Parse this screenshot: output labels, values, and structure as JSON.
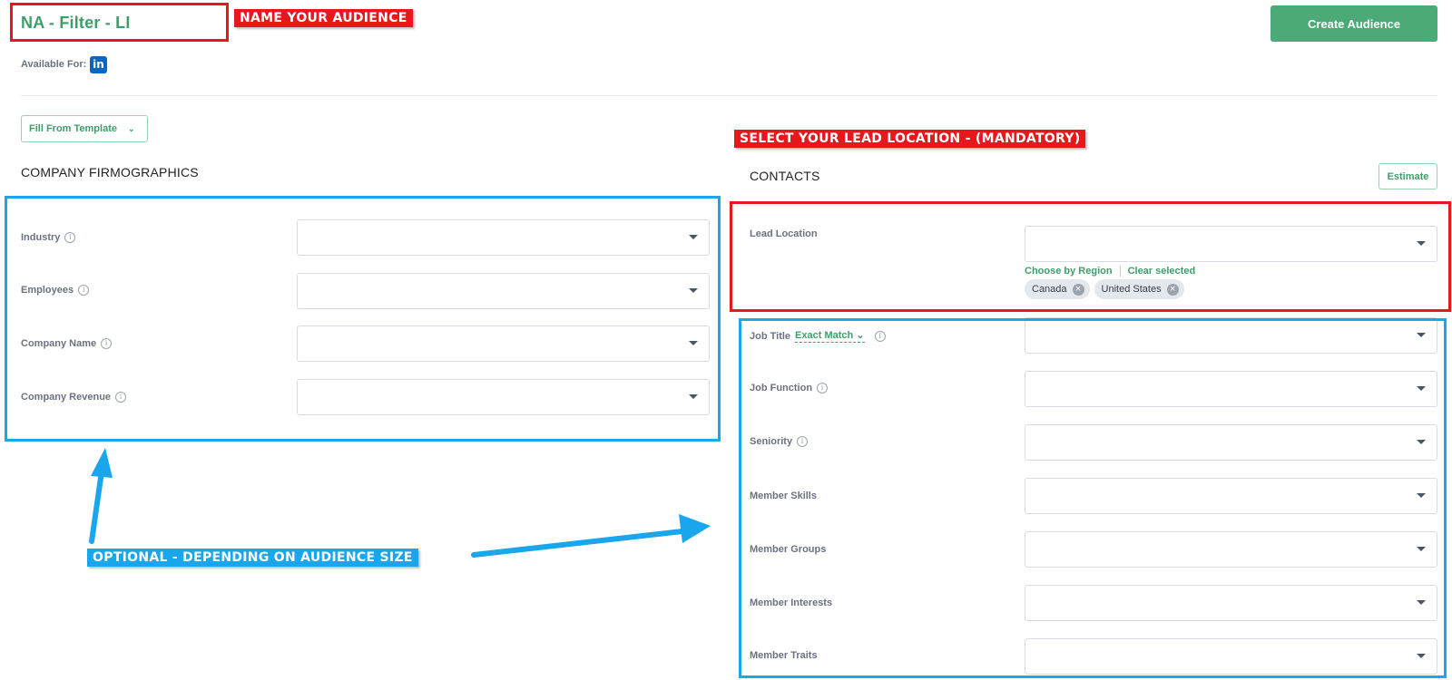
{
  "header": {
    "audience_name": "NA - Filter - LI",
    "available_for_label": "Available For:",
    "linkedin_icon": "linkedin-icon",
    "create_button": "Create Audience"
  },
  "toolbar": {
    "template_button": "Fill From Template"
  },
  "company": {
    "title": "COMPANY FIRMOGRAPHICS",
    "fields": [
      {
        "label": "Industry",
        "info": true
      },
      {
        "label": "Employees",
        "info": true
      },
      {
        "label": "Company Name",
        "info": true
      },
      {
        "label": "Company Revenue",
        "info": true
      }
    ]
  },
  "contacts": {
    "title": "CONTACTS",
    "estimate_button": "Estimate",
    "lead_location": {
      "label": "Lead Location",
      "choose_by_region": "Choose by Region",
      "clear_selected": "Clear selected",
      "selected": [
        "Canada",
        "United States"
      ]
    },
    "job_title": {
      "label": "Job Title",
      "match_mode": "Exact Match",
      "info": true
    },
    "fields": [
      {
        "label": "Job Function",
        "info": true
      },
      {
        "label": "Seniority",
        "info": true
      },
      {
        "label": "Member Skills",
        "info": false
      },
      {
        "label": "Member Groups",
        "info": false
      },
      {
        "label": "Member Interests",
        "info": false
      },
      {
        "label": "Member Traits",
        "info": false
      }
    ]
  },
  "annotations": {
    "name_audience": "NAME YOUR AUDIENCE",
    "lead_location": "SELECT YOUR LEAD LOCATION - (MANDATORY)",
    "optional": "OPTIONAL - DEPENDING ON AUDIENCE SIZE"
  },
  "colors": {
    "brand_green": "#4caa79",
    "link_green": "#3f9d6b",
    "annotation_red": "#e8171c",
    "annotation_blue": "#1aa6ec",
    "linkedin_blue": "#0a66c2"
  }
}
